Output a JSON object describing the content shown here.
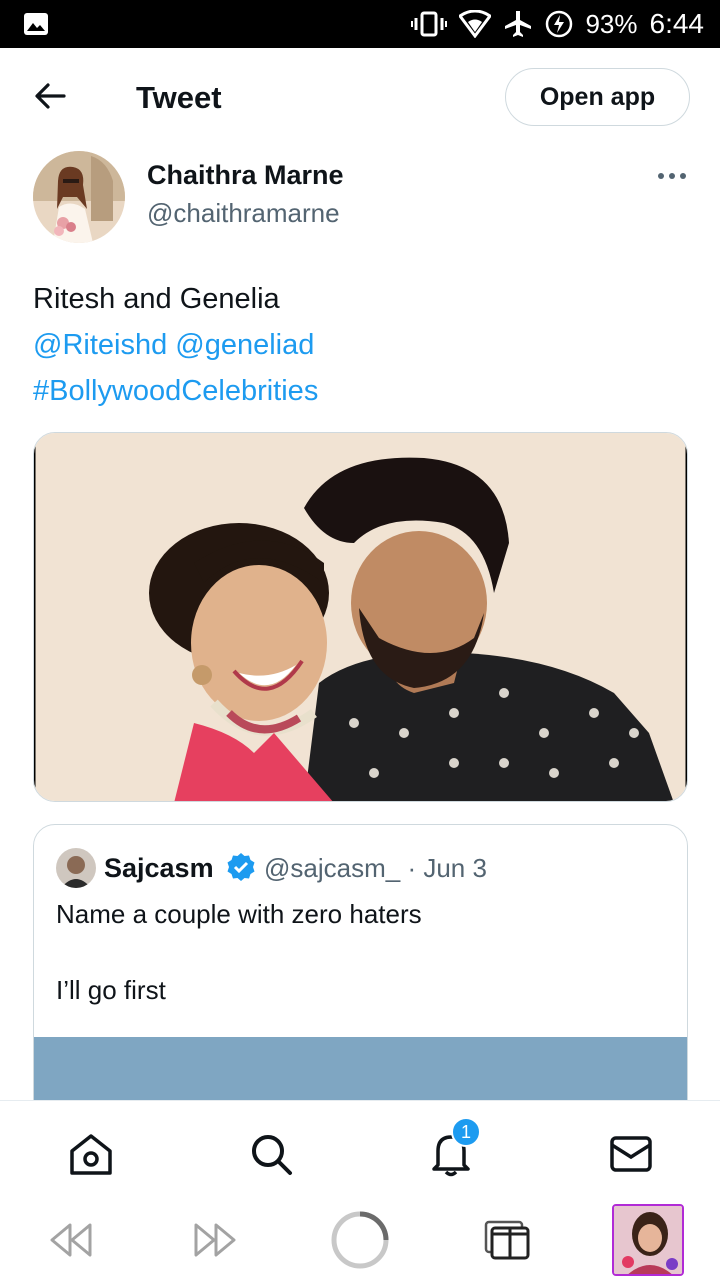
{
  "status_bar": {
    "battery": "93%",
    "time": "6:44"
  },
  "header": {
    "title": "Tweet",
    "open_app_label": "Open app"
  },
  "tweet": {
    "author_name": "Chaithra Marne",
    "author_handle": "@chaithramarne",
    "text_line1": "Ritesh and Genelia",
    "mention1": "@Riteishd",
    "mention2": "@geneliad",
    "hashtag": "#BollywoodCelebrities"
  },
  "quote": {
    "author_name": "Sajcasm",
    "author_handle": "@sajcasm_",
    "date": "· Jun 3",
    "line1": "Name a couple with zero haters",
    "line2": "I’ll go first"
  },
  "bottom_nav": {
    "notifications_badge": "1"
  },
  "colors": {
    "accent": "#1d9bf0",
    "text": "#0f1419",
    "secondary": "#536471",
    "border": "#cfd9de"
  }
}
